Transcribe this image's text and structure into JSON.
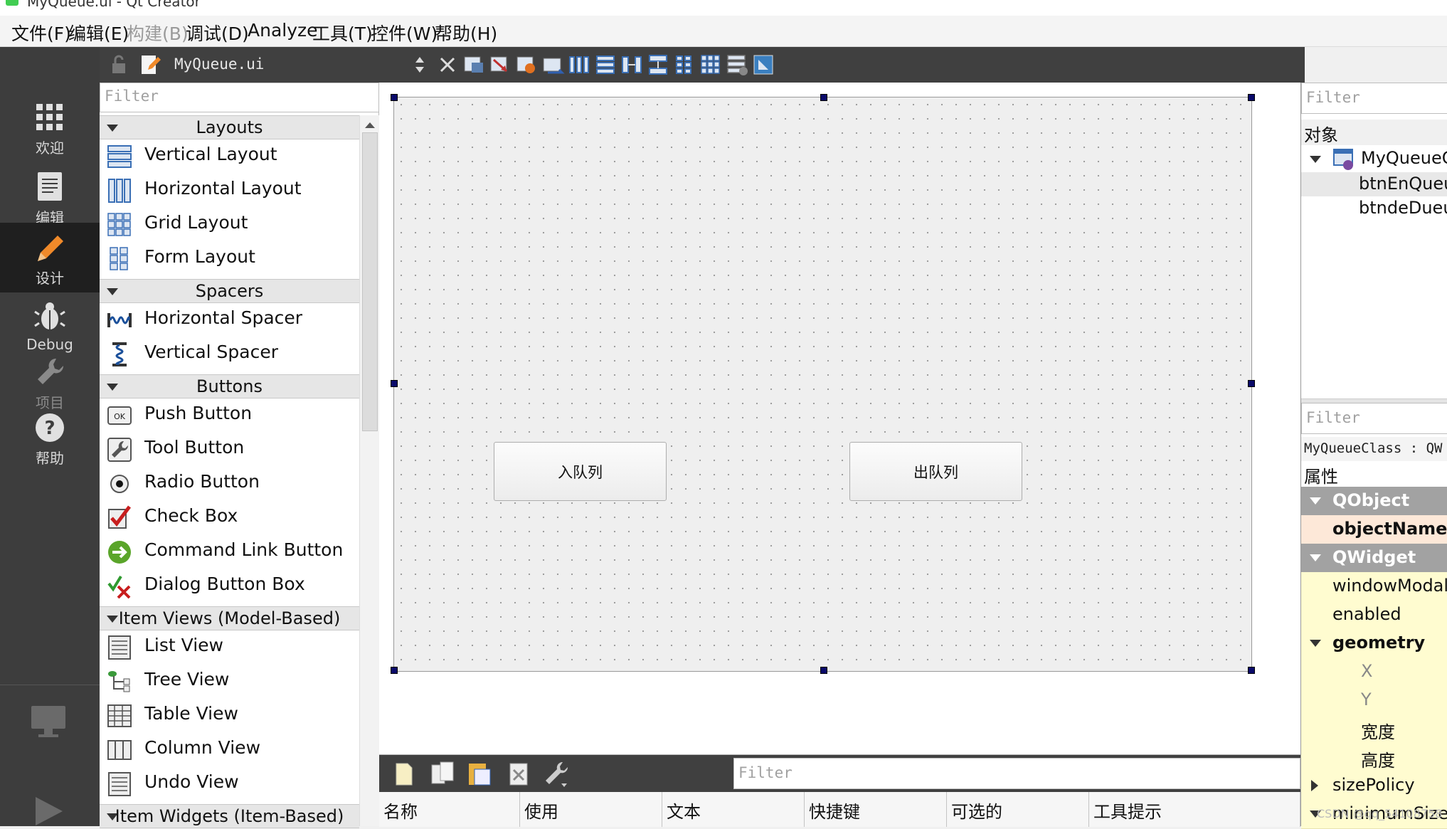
{
  "window": {
    "title": "MyQueue.ui - Qt Creator"
  },
  "menu": [
    "文件(F)",
    "编辑(E)",
    "构建(B)",
    "调试(D)",
    "Analyze",
    "工具(T)",
    "控件(W)",
    "帮助(H)"
  ],
  "modes": [
    {
      "label": "欢迎",
      "icon": "grid-icon"
    },
    {
      "label": "编辑",
      "icon": "document-icon"
    },
    {
      "label": "设计",
      "icon": "pencil-icon"
    },
    {
      "label": "Debug",
      "icon": "bug-icon"
    },
    {
      "label": "项目",
      "icon": "wrench-icon"
    },
    {
      "label": "帮助",
      "icon": "help-icon"
    }
  ],
  "document": {
    "filename": "MyQueue.ui"
  },
  "widgetbox": {
    "filter_placeholder": "Filter",
    "categories": {
      "layouts": "Layouts",
      "spacers": "Spacers",
      "buttons": "Buttons",
      "item_views": "Item Views (Model-Based)",
      "item_widgets": "Item Widgets (Item-Based)"
    },
    "items": {
      "vertical_layout": "Vertical Layout",
      "horizontal_layout": "Horizontal Layout",
      "grid_layout": "Grid Layout",
      "form_layout": "Form Layout",
      "horizontal_spacer": "Horizontal Spacer",
      "vertical_spacer": "Vertical Spacer",
      "push_button": "Push Button",
      "tool_button": "Tool Button",
      "radio_button": "Radio Button",
      "check_box": "Check Box",
      "command_link_button": "Command Link Button",
      "dialog_button_box": "Dialog Button Box",
      "list_view": "List View",
      "tree_view": "Tree View",
      "table_view": "Table View",
      "column_view": "Column View",
      "undo_view": "Undo View"
    }
  },
  "form": {
    "btn_enqueue": "入队列",
    "btn_dequeue": "出队列"
  },
  "action_editor": {
    "filter_placeholder": "Filter",
    "columns": [
      "名称",
      "使用",
      "文本",
      "快捷键",
      "可选的",
      "工具提示"
    ]
  },
  "object_inspector": {
    "filter_placeholder": "Filter",
    "header": "对象",
    "root": "MyQueueC",
    "children": [
      "btnEnQueu",
      "btndeDueu"
    ]
  },
  "property_editor": {
    "filter_placeholder": "Filter",
    "class_line": "MyQueueClass : QW",
    "header": "属性",
    "rows": {
      "qobject": "QObject",
      "objectname": "objectName",
      "qwidget": "QWidget",
      "windowmodal": "windowModal",
      "enabled": "enabled",
      "geometry": "geometry",
      "x": "X",
      "y": "Y",
      "width": "宽度",
      "height": "高度",
      "sizepolicy": "sizePolicy",
      "minimumsize": "minimumSize"
    }
  },
  "watermark": "CSDN @qq_54108758",
  "colors": {
    "sidebar": "#3d3d3d",
    "active_mode": "#1f1f1f",
    "property_group": "#a2a2a2",
    "property_row": "#fffcd0",
    "selection_handle": "#0a0a6a"
  }
}
